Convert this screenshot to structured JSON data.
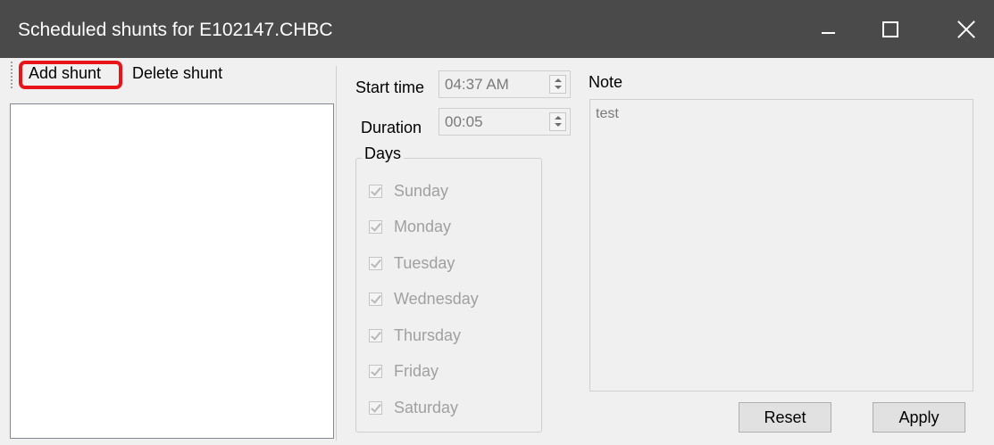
{
  "window": {
    "title": "Scheduled shunts for E102147.CHBC",
    "controls": [
      "minimize-icon",
      "maximize-icon",
      "close-icon"
    ]
  },
  "toolbar": {
    "add_label": "Add shunt",
    "delete_label": "Delete shunt"
  },
  "schedule": {
    "start_time_label": "Start time",
    "start_time_value": "04:37 AM",
    "duration_label": "Duration",
    "duration_value": "00:05"
  },
  "days": {
    "legend": "Days",
    "items": [
      {
        "label": "Sunday",
        "checked": true
      },
      {
        "label": "Monday",
        "checked": true
      },
      {
        "label": "Tuesday",
        "checked": true
      },
      {
        "label": "Wednesday",
        "checked": true
      },
      {
        "label": "Thursday",
        "checked": true
      },
      {
        "label": "Friday",
        "checked": true
      },
      {
        "label": "Saturday",
        "checked": true
      }
    ]
  },
  "note": {
    "label": "Note",
    "value": "test"
  },
  "buttons": {
    "reset": "Reset",
    "apply": "Apply"
  },
  "colors": {
    "titlebar": "#4a4a4a",
    "highlight": "#e8141a"
  }
}
